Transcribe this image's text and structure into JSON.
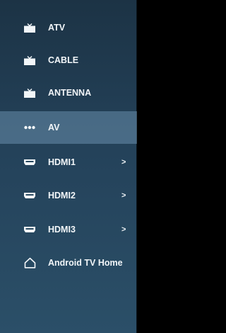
{
  "menu": {
    "items": [
      {
        "label": "ATV",
        "icon": "tv-icon"
      },
      {
        "label": "CABLE",
        "icon": "tv-icon"
      },
      {
        "label": "ANTENNA",
        "icon": "tv-icon"
      },
      {
        "label": "AV",
        "icon": "av-dots-icon",
        "selected": true
      },
      {
        "label": "HDMI1",
        "icon": "hdmi-icon",
        "arrow": ">"
      },
      {
        "label": "HDMI2",
        "icon": "hdmi-icon",
        "arrow": ">"
      },
      {
        "label": "HDMI3",
        "icon": "hdmi-icon",
        "arrow": ">"
      },
      {
        "label": "Android TV Home",
        "icon": "home-icon"
      }
    ]
  },
  "colors": {
    "panel_top": "#1c3345",
    "panel_bottom": "#2b4f68",
    "text": "#f2f6f9",
    "selected": "#5f8199"
  }
}
